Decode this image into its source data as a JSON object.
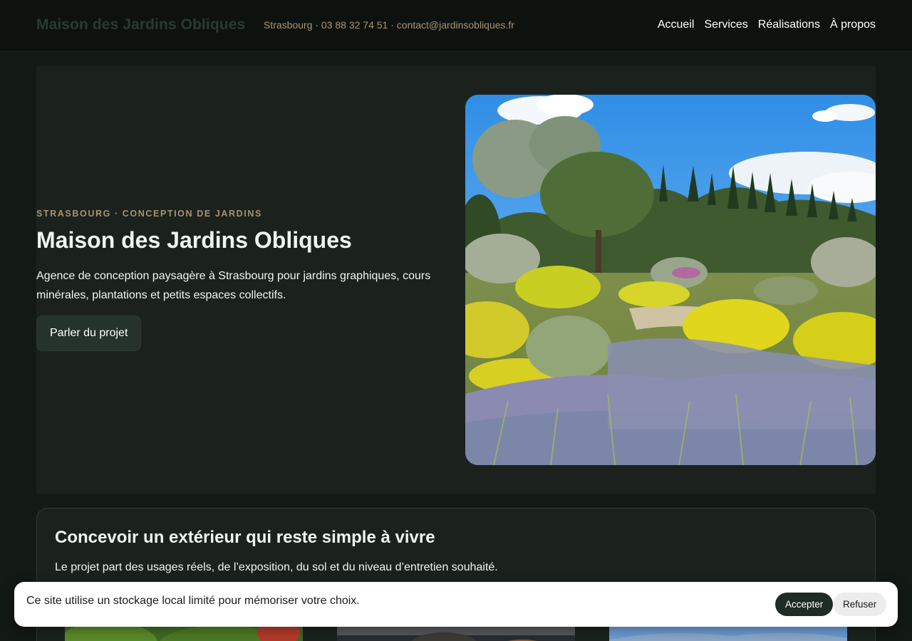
{
  "header": {
    "brand": "Maison des Jardins Obliques",
    "contact": "Strasbourg · 03 88 32 74 51 · contact@jardinsobliques.fr",
    "nav": [
      "Accueil",
      "Services",
      "Réalisations",
      "À propos"
    ]
  },
  "hero": {
    "eyebrow": "STRASBOURG · CONCEPTION DE JARDINS",
    "title": "Maison des Jardins Obliques",
    "description": "Agence de conception paysagère à Strasbourg pour jardins graphiques, cours minérales, plantations et petits espaces collectifs.",
    "cta_label": "Parler du projet",
    "image_alt": "Jardin méditerranéen avec oliviers, cyprès, lavandes et santolines en fleurs jaunes"
  },
  "intro": {
    "title": "Concevoir un extérieur qui reste simple à vivre",
    "text": "Le projet part des usages réels, de l’exposition, du sol et du niveau d’entretien souhaité."
  },
  "cookie": {
    "message": "Ce site utilise un stockage local limité pour mémoriser votre choix.",
    "accept_label": "Accepter",
    "refuse_label": "Refuser"
  },
  "colors": {
    "page_bg": "#131915",
    "hero_bg": "#1b221e",
    "accent_gold": "#a89370",
    "button_dark": "#1f2b25"
  }
}
